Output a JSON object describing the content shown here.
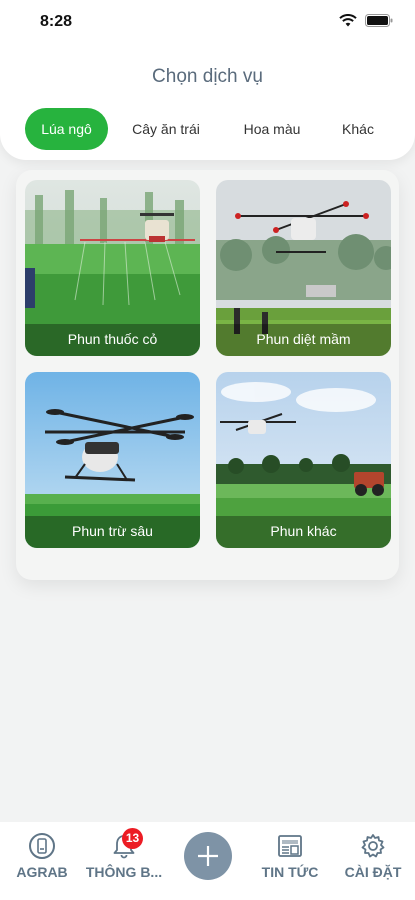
{
  "status_bar": {
    "time": "8:28"
  },
  "header": {
    "title": "Chọn dịch vụ"
  },
  "tabs": [
    {
      "label": "Lúa ngô",
      "active": true
    },
    {
      "label": "Cây ăn trái",
      "active": false
    },
    {
      "label": "Hoa màu",
      "active": false
    },
    {
      "label": "Khác",
      "active": false
    }
  ],
  "services": [
    {
      "label": "Phun thuốc cỏ"
    },
    {
      "label": "Phun diệt mầm"
    },
    {
      "label": "Phun trừ sâu"
    },
    {
      "label": "Phun khác"
    }
  ],
  "bottom_nav": {
    "items": [
      {
        "label": "AGRAB",
        "icon": "agrab-logo-icon"
      },
      {
        "label": "THÔNG B...",
        "icon": "bell-icon",
        "badge": "13"
      },
      {
        "label": "TIN TỨC",
        "icon": "newspaper-icon"
      },
      {
        "label": "CÀI ĐẶT",
        "icon": "gear-icon"
      }
    ],
    "add_icon": "plus-icon"
  },
  "colors": {
    "accent_green": "#27b33e",
    "nav_gray": "#5f7587",
    "badge_red": "#ec1c24",
    "add_button": "#7e93a6"
  }
}
